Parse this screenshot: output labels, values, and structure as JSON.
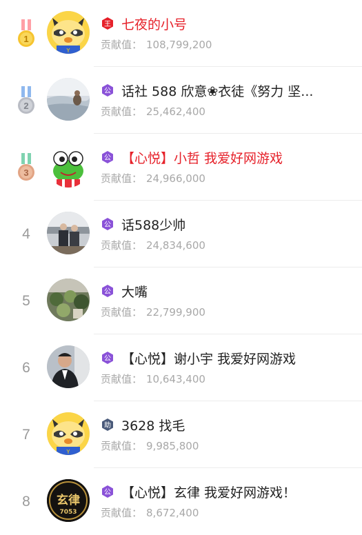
{
  "contribution_label": "贡献值：",
  "colors": {
    "highlight_name": "#e6212a",
    "normal_name": "#222222",
    "secondary": "#a8a8a8"
  },
  "rows": [
    {
      "rank": "1",
      "medal": "gold",
      "badge": "王",
      "badge_color": "#e6212a",
      "avatar": "raccoon-mascot",
      "name": "七夜的小号",
      "name_color": "red",
      "value": "108,799,200"
    },
    {
      "rank": "2",
      "medal": "silver",
      "badge": "公",
      "badge_color": "#8a52d8",
      "avatar": "photo-landscape",
      "name": "话社 588 欣意❀衣徒《努力 坚...",
      "name_color": "normal",
      "value": "25,462,400"
    },
    {
      "rank": "3",
      "medal": "bronze",
      "badge": "公",
      "badge_color": "#8a52d8",
      "avatar": "frog-cartoon",
      "name": "【心悦】小哲 我爱好网游戏",
      "name_color": "red",
      "value": "24,966,000"
    },
    {
      "rank": "4",
      "medal": "",
      "badge": "公",
      "badge_color": "#8a52d8",
      "avatar": "photo-people",
      "name": "话588少帅",
      "name_color": "normal",
      "value": "24,834,600"
    },
    {
      "rank": "5",
      "medal": "",
      "badge": "公",
      "badge_color": "#8a52d8",
      "avatar": "photo-plants",
      "name": "大嘴",
      "name_color": "normal",
      "value": "22,799,900"
    },
    {
      "rank": "6",
      "medal": "",
      "badge": "公",
      "badge_color": "#8a52d8",
      "avatar": "photo-man",
      "name": "【心悦】谢小宇 我爱好网游戏",
      "name_color": "normal",
      "value": "10,643,400"
    },
    {
      "rank": "7",
      "medal": "",
      "badge": "助",
      "badge_color": "#4a5a7a",
      "avatar": "raccoon-mascot",
      "name": "3628 找毛",
      "name_color": "normal",
      "value": "9,985,800"
    },
    {
      "rank": "8",
      "medal": "",
      "badge": "公",
      "badge_color": "#8a52d8",
      "avatar": "gold-emblem",
      "avatar_text": "玄律",
      "avatar_num": "7053",
      "name": "【心悦】玄律 我爱好网游戏！",
      "name_color": "normal",
      "value": "8,672,400"
    }
  ]
}
